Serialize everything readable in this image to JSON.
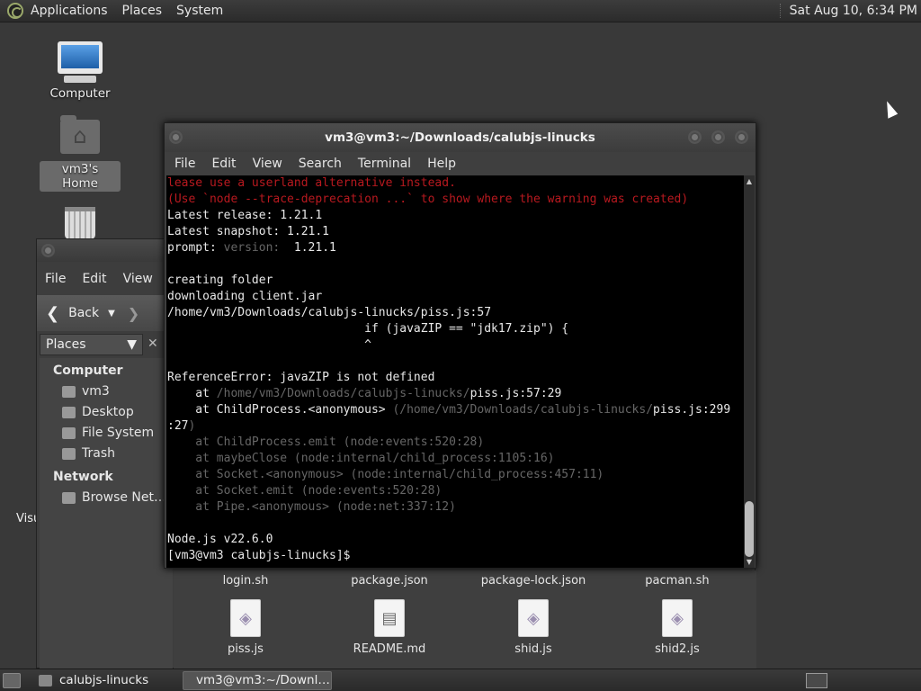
{
  "top_panel": {
    "menus": [
      "Applications",
      "Places",
      "System"
    ],
    "clock": "Sat Aug 10,  6:34 PM"
  },
  "desktop_icons": {
    "computer": "Computer",
    "home": "vm3's Home",
    "partial_label": "Visu"
  },
  "file_manager": {
    "menus": [
      "File",
      "Edit",
      "View"
    ],
    "toolbar": {
      "back_label": "Back"
    },
    "places_label": "Places",
    "sidebar": {
      "computer_heading": "Computer",
      "computer_items": [
        "vm3",
        "Desktop",
        "File System",
        "Trash"
      ],
      "network_heading": "Network",
      "network_items": [
        "Browse Net…"
      ]
    },
    "top_row_files": [
      "login.sh",
      "package.json",
      "package-lock.json",
      "pacman.sh"
    ],
    "files": [
      "piss.js",
      "README.md",
      "shid.js",
      "shid2.js"
    ]
  },
  "terminal": {
    "title": "vm3@vm3:~/Downloads/calubjs-linucks",
    "menus": [
      "File",
      "Edit",
      "View",
      "Search",
      "Terminal",
      "Help"
    ],
    "lines": {
      "l1": "lease use a userland alternative instead.",
      "l2": "(Use `node --trace-deprecation ...` to show where the warning was created)",
      "l3": "Latest release: 1.21.1",
      "l4": "Latest snapshot: 1.21.1",
      "l5a": "prompt: ",
      "l5b": "version:",
      "l5c": "  1.21.1",
      "l6": "",
      "l7": "creating folder",
      "l8": "downloading client.jar",
      "l9": "/home/vm3/Downloads/calubjs-linucks/piss.js:57",
      "l10": "                            if (javaZIP == \"jdk17.zip\") {",
      "l11": "                            ^",
      "l12": "",
      "l13": "ReferenceError: javaZIP is not defined",
      "l14a": "    at ",
      "l14b": "/home/vm3/Downloads/calubjs-linucks/",
      "l14c": "piss.js:57:29",
      "l15a": "    at ChildProcess.<anonymous> ",
      "l15b": "(/home/vm3/Downloads/calubjs-linucks/",
      "l15c": "piss.js:299",
      "l16a": ":27",
      "l16b": ")",
      "l17": "    at ChildProcess.emit (node:events:520:28)",
      "l18": "    at maybeClose (node:internal/child_process:1105:16)",
      "l19": "    at Socket.<anonymous> (node:internal/child_process:457:11)",
      "l20": "    at Socket.emit (node:events:520:28)",
      "l21": "    at Pipe.<anonymous> (node:net:337:12)",
      "l22": "",
      "l23": "Node.js v22.6.0",
      "l24": "[vm3@vm3 calubjs-linucks]$ "
    }
  },
  "bottom_panel": {
    "tasks": [
      "calubjs-linucks",
      "vm3@vm3:~/Downl…"
    ]
  }
}
